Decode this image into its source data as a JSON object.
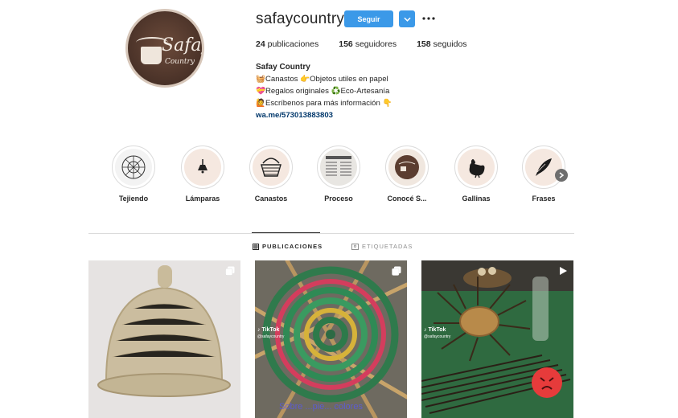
{
  "profile": {
    "username": "safaycountry",
    "follow_label": "Seguir",
    "avatar_logo_text": "Safay",
    "avatar_logo_sub": "Country",
    "stats": [
      {
        "count": "24",
        "label": "publicaciones"
      },
      {
        "count": "156",
        "label": "seguidores"
      },
      {
        "count": "158",
        "label": "seguidos"
      }
    ],
    "bio": {
      "name": "Safay Country",
      "lines": [
        "🧺Canastos 👉Objetos utiles en papel",
        "💝Regalos originales ♻️Eco-Artesanía",
        "🙋Escríbenos para más información 👇"
      ],
      "link": "wa.me/573013883803"
    }
  },
  "highlights": [
    {
      "label": "Tejiendo",
      "icon": "yarn-wheel-icon"
    },
    {
      "label": "Lámparas",
      "icon": "lamp-icon"
    },
    {
      "label": "Canastos",
      "icon": "basket-icon"
    },
    {
      "label": "Proceso",
      "icon": "newspaper-icon"
    },
    {
      "label": "Conocé S...",
      "icon": "logo-icon"
    },
    {
      "label": "Gallinas",
      "icon": "hen-icon"
    },
    {
      "label": "Frases",
      "icon": "quill-icon"
    }
  ],
  "tabs": {
    "publicaciones": "PUBLICACIONES",
    "etiquetadas": "ETIQUETADAS"
  },
  "posts": [
    {
      "type": "carousel",
      "icon": "carousel-icon"
    },
    {
      "type": "video",
      "icon": "carousel-icon",
      "tiktok": "TikTok",
      "tiktok_user": "@safaycountry",
      "caption": "Sobre ...pie... colores"
    },
    {
      "type": "video",
      "icon": "video-play-icon",
      "tiktok": "TikTok",
      "tiktok_user": "@safaycountry"
    }
  ],
  "colors": {
    "follow_button": "#3b99e8",
    "link": "#00376b",
    "divider": "#dbdbdb"
  }
}
